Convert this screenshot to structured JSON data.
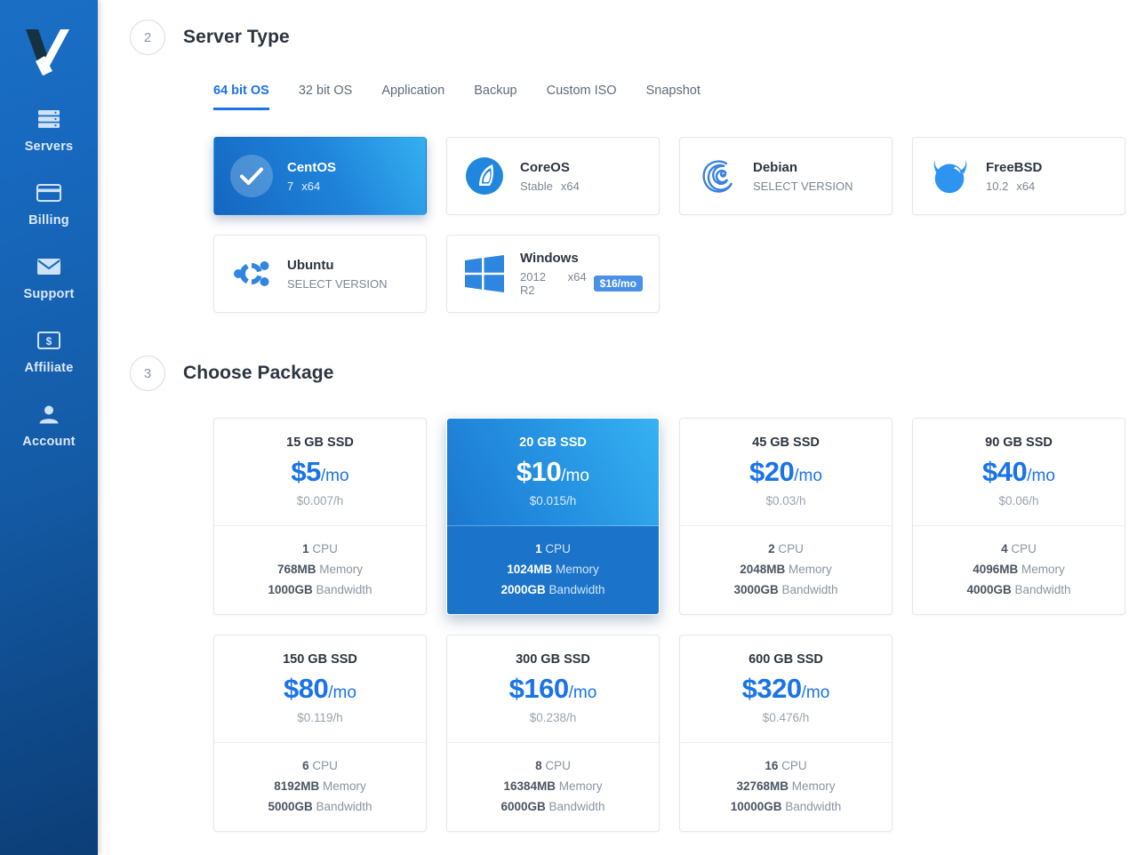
{
  "sidebar": {
    "logo_name": "vultr-checkmark-logo",
    "items": [
      {
        "label": "Servers",
        "icon": "server-stack-icon"
      },
      {
        "label": "Billing",
        "icon": "credit-card-icon"
      },
      {
        "label": "Support",
        "icon": "envelope-icon"
      },
      {
        "label": "Affiliate",
        "icon": "dollar-bill-icon"
      },
      {
        "label": "Account",
        "icon": "person-icon"
      }
    ]
  },
  "colors": {
    "accent": "#1a73e8",
    "sidebar_top": "#1a6fc4",
    "sidebar_bottom": "#0c3e77",
    "selected_card_from": "#1566c0",
    "selected_card_to": "#35b0f0",
    "badge": "#4a90e8"
  },
  "server_type": {
    "step": "2",
    "title": "Server Type",
    "tabs": [
      {
        "label": "64 bit OS",
        "active": true
      },
      {
        "label": "32 bit OS",
        "active": false
      },
      {
        "label": "Application",
        "active": false
      },
      {
        "label": "Backup",
        "active": false
      },
      {
        "label": "Custom ISO",
        "active": false
      },
      {
        "label": "Snapshot",
        "active": false
      }
    ],
    "os_options": [
      {
        "name": "CentOS",
        "version": "7",
        "arch": "x64",
        "selected": true,
        "icon": "check-circle-icon",
        "badge": ""
      },
      {
        "name": "CoreOS",
        "version": "Stable",
        "arch": "x64",
        "selected": false,
        "icon": "coreos-logo",
        "badge": ""
      },
      {
        "name": "Debian",
        "version": "SELECT VERSION",
        "arch": "",
        "selected": false,
        "icon": "debian-logo",
        "badge": ""
      },
      {
        "name": "FreeBSD",
        "version": "10.2",
        "arch": "x64",
        "selected": false,
        "icon": "freebsd-logo",
        "badge": ""
      },
      {
        "name": "Ubuntu",
        "version": "SELECT VERSION",
        "arch": "",
        "selected": false,
        "icon": "ubuntu-logo",
        "badge": ""
      },
      {
        "name": "Windows",
        "version": "2012 R2",
        "arch": "x64",
        "selected": false,
        "icon": "windows-logo",
        "badge": "$16/mo"
      }
    ]
  },
  "choose_package": {
    "step": "3",
    "title": "Choose Package",
    "packages": [
      {
        "storage": "15 GB SSD",
        "price": "$5",
        "per": "/mo",
        "hourly": "$0.007/h",
        "cpu": "1",
        "cpu_label": "CPU",
        "memory": "768MB",
        "memory_label": "Memory",
        "bandwidth": "1000GB",
        "bandwidth_label": "Bandwidth",
        "selected": false
      },
      {
        "storage": "20 GB SSD",
        "price": "$10",
        "per": "/mo",
        "hourly": "$0.015/h",
        "cpu": "1",
        "cpu_label": "CPU",
        "memory": "1024MB",
        "memory_label": "Memory",
        "bandwidth": "2000GB",
        "bandwidth_label": "Bandwidth",
        "selected": true
      },
      {
        "storage": "45 GB SSD",
        "price": "$20",
        "per": "/mo",
        "hourly": "$0.03/h",
        "cpu": "2",
        "cpu_label": "CPU",
        "memory": "2048MB",
        "memory_label": "Memory",
        "bandwidth": "3000GB",
        "bandwidth_label": "Bandwidth",
        "selected": false
      },
      {
        "storage": "90 GB SSD",
        "price": "$40",
        "per": "/mo",
        "hourly": "$0.06/h",
        "cpu": "4",
        "cpu_label": "CPU",
        "memory": "4096MB",
        "memory_label": "Memory",
        "bandwidth": "4000GB",
        "bandwidth_label": "Bandwidth",
        "selected": false
      },
      {
        "storage": "150 GB SSD",
        "price": "$80",
        "per": "/mo",
        "hourly": "$0.119/h",
        "cpu": "6",
        "cpu_label": "CPU",
        "memory": "8192MB",
        "memory_label": "Memory",
        "bandwidth": "5000GB",
        "bandwidth_label": "Bandwidth",
        "selected": false
      },
      {
        "storage": "300 GB SSD",
        "price": "$160",
        "per": "/mo",
        "hourly": "$0.238/h",
        "cpu": "8",
        "cpu_label": "CPU",
        "memory": "16384MB",
        "memory_label": "Memory",
        "bandwidth": "6000GB",
        "bandwidth_label": "Bandwidth",
        "selected": false
      },
      {
        "storage": "600 GB SSD",
        "price": "$320",
        "per": "/mo",
        "hourly": "$0.476/h",
        "cpu": "16",
        "cpu_label": "CPU",
        "memory": "32768MB",
        "memory_label": "Memory",
        "bandwidth": "10000GB",
        "bandwidth_label": "Bandwidth",
        "selected": false
      }
    ]
  }
}
